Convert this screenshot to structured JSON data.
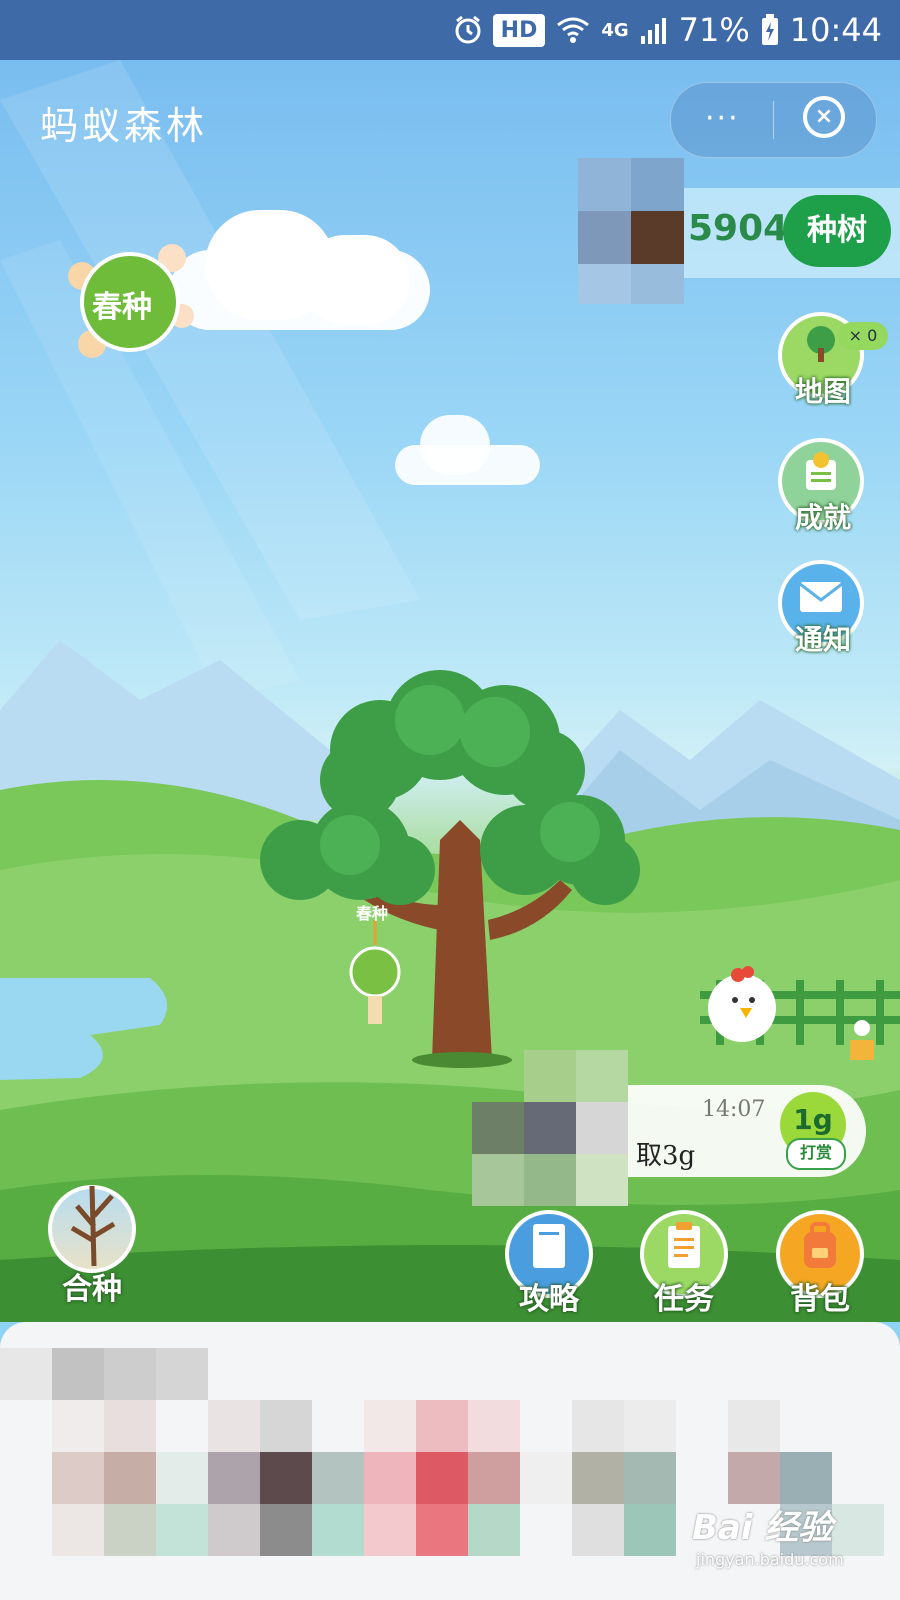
{
  "status_bar": {
    "hd": "HD",
    "network": "4G",
    "battery": "71%",
    "time": "10:44"
  },
  "header": {
    "title": "蚂蚁森林",
    "more": "···"
  },
  "energy": {
    "value": "5904g",
    "plant_button": "种树"
  },
  "spring_badge": "春种",
  "side_menu": {
    "map": "地图",
    "map_count": "× 0",
    "achievement": "成就",
    "notice": "通知"
  },
  "tree_tag": "春种",
  "message": {
    "time": "14:07",
    "text": "取3g",
    "reward_amount": "1g",
    "reward_label": "打赏"
  },
  "bottom_menu": {
    "co_plant": "合种",
    "guide": "攻略",
    "tasks": "任务",
    "bag": "背包"
  },
  "watermark": {
    "brand": "Bai 经验",
    "url": "jingyan.baidu.com"
  },
  "colors": {
    "status_bar": "#3f6aa8",
    "primary_green": "#1ea04a"
  }
}
